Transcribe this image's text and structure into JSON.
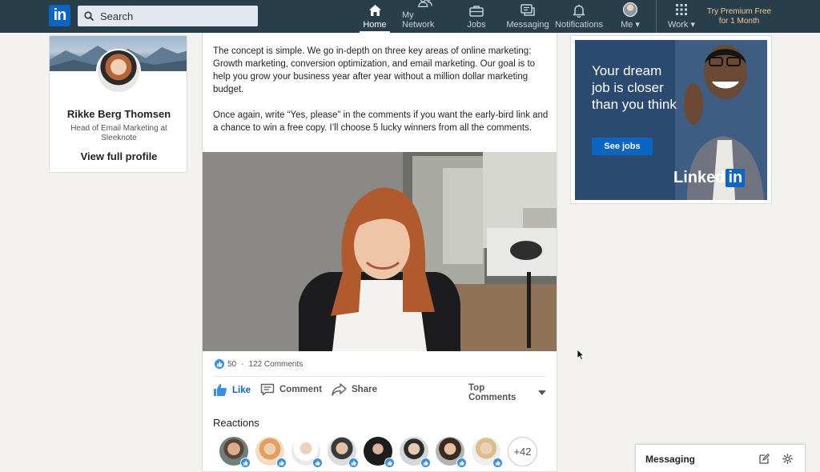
{
  "nav": {
    "logo_text": "in",
    "search_placeholder": "Search",
    "items": [
      {
        "label": "Home",
        "icon": "home-icon",
        "active": true
      },
      {
        "label": "My Network",
        "icon": "network-icon"
      },
      {
        "label": "Jobs",
        "icon": "briefcase-icon"
      },
      {
        "label": "Messaging",
        "icon": "chat-icon"
      },
      {
        "label": "Notifications",
        "icon": "bell-icon"
      },
      {
        "label": "Me",
        "icon": "avatar"
      },
      {
        "label": "Work",
        "icon": "grid-icon"
      }
    ],
    "premium_line1": "Try Premium Free",
    "premium_line2": "for 1 Month"
  },
  "profile": {
    "name": "Rikke Berg Thomsen",
    "headline": "Head of Email Marketing at Sleeknote",
    "link": "View full profile"
  },
  "post": {
    "paragraph1": "The concept is simple. We go in-depth on three key areas of online marketing: Growth marketing, conversion optimization, and email marketing. Our goal is to help you grow your business year after year without a million dollar marketing budget.",
    "paragraph2": "Once again, write “Yes, please” in the comments if you want the early-bird link and a chance to win a free copy. I’ll choose 5 lucky winners from all the comments.",
    "likes": "50",
    "comments": "122 Comments",
    "like_label": "Like",
    "comment_label": "Comment",
    "share_label": "Share",
    "sort_label": "Top Comments",
    "reactions_title": "Reactions",
    "more_reactors": "+42"
  },
  "ad": {
    "headline": "Your dream job is closer than you think",
    "button": "See jobs",
    "logo_text": "Linked",
    "logo_in": "in"
  },
  "messaging": {
    "label": "Messaging"
  },
  "colors": {
    "nav_bg": "#283e4a",
    "accent": "#0a66c2",
    "premium": "#f5c990"
  }
}
